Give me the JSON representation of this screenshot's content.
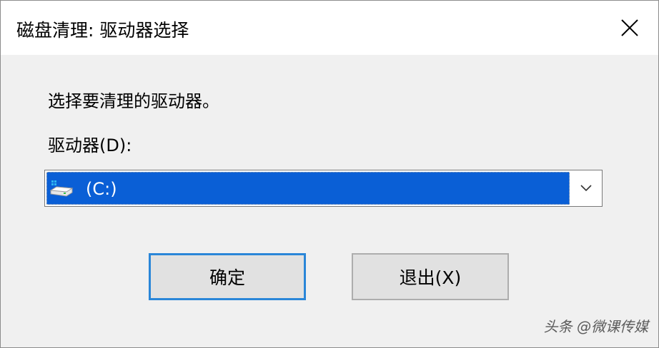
{
  "window": {
    "title": "磁盘清理: 驱动器选择"
  },
  "dialog": {
    "prompt": "选择要清理的驱动器。",
    "drive_label": "驱动器(D):",
    "drive_select": {
      "selected": "(C:)",
      "icon": "drive-icon"
    },
    "ok_label": "确定",
    "exit_label": "退出(X)"
  },
  "watermark": "头条 @微课传媒",
  "colors": {
    "selection": "#0a5fd6",
    "default_button_border": "#2a86d8",
    "dialog_bg": "#f0f0f0"
  }
}
